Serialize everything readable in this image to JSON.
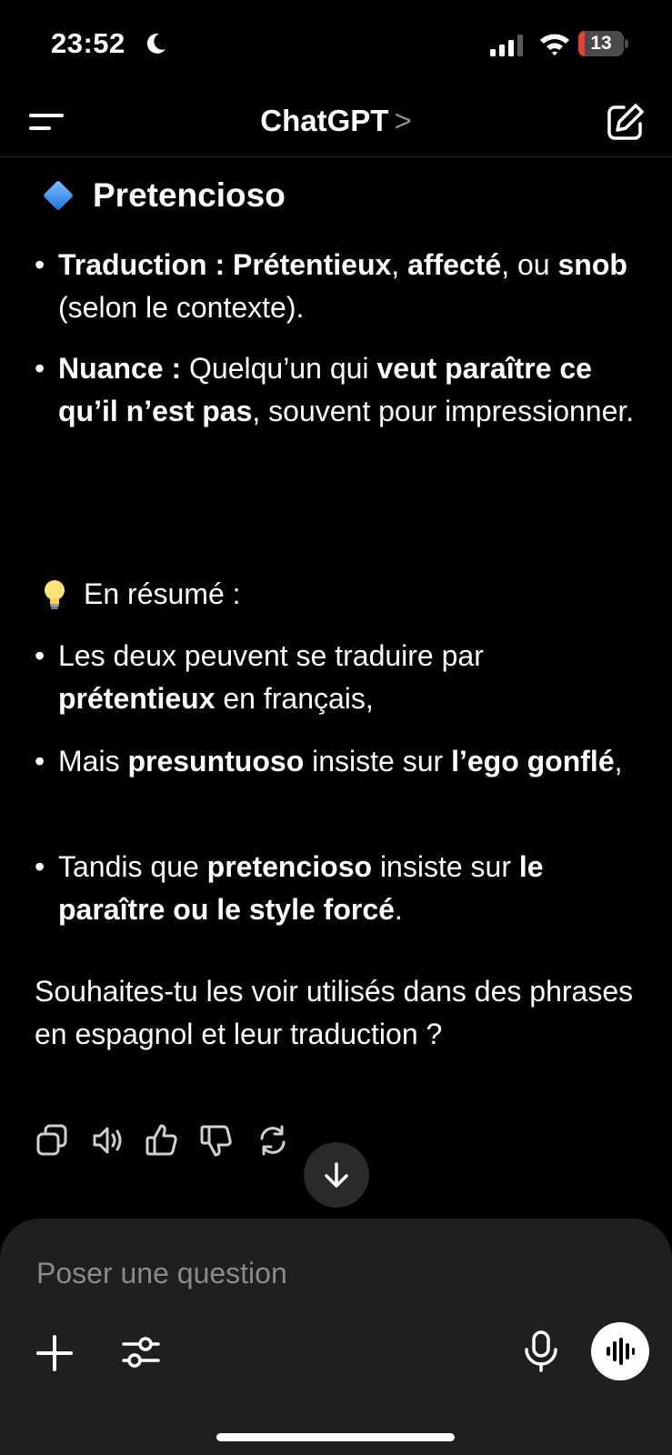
{
  "status": {
    "time": "23:52",
    "battery_level": "13",
    "battery_fraction": 0.13,
    "battery_color": "#e5403a"
  },
  "header": {
    "title": "ChatGPT",
    "chevron": ">"
  },
  "message": {
    "heading": "Pretencioso",
    "bullets_top": [
      {
        "parts": [
          "Traduction : Prétentieux",
          ", ",
          "affecté",
          ",",
          " ou ",
          "snob",
          " (selon le contexte)."
        ]
      },
      {
        "parts": [
          "Nuance :",
          " Quelqu’un qui ",
          "veut paraître ce qu’il n’est pas",
          ", souvent pour impressionner."
        ]
      }
    ],
    "summary_label": "En résumé :",
    "bullets_summary": [
      {
        "parts": [
          "Les deux peuvent se traduire par ",
          "prétentieux",
          " en français,"
        ]
      },
      {
        "parts": [
          "Mais ",
          "presuntuoso",
          " insiste sur ",
          "l’ego gonflé",
          ","
        ]
      },
      {
        "parts": [
          "Tandis que ",
          "pretencioso",
          " insiste sur ",
          "le paraître ou le style forcé",
          "."
        ]
      }
    ],
    "closing": "Souhaites-tu les voir utilisés dans des phrases en espagnol et leur traduction ?"
  },
  "actions": {
    "icons": [
      "copy-icon",
      "speaker-icon",
      "thumbs-up-icon",
      "thumbs-down-icon",
      "regenerate-icon"
    ],
    "scroll_icon": "arrow-down-icon"
  },
  "composer": {
    "placeholder": "Poser une question",
    "icons": [
      "plus-icon",
      "sliders-icon",
      "microphone-icon",
      "voice-wave-icon"
    ]
  },
  "colors": {
    "background": "#000000",
    "composer": "#1f1f1f",
    "muted": "#8a8a8a"
  }
}
